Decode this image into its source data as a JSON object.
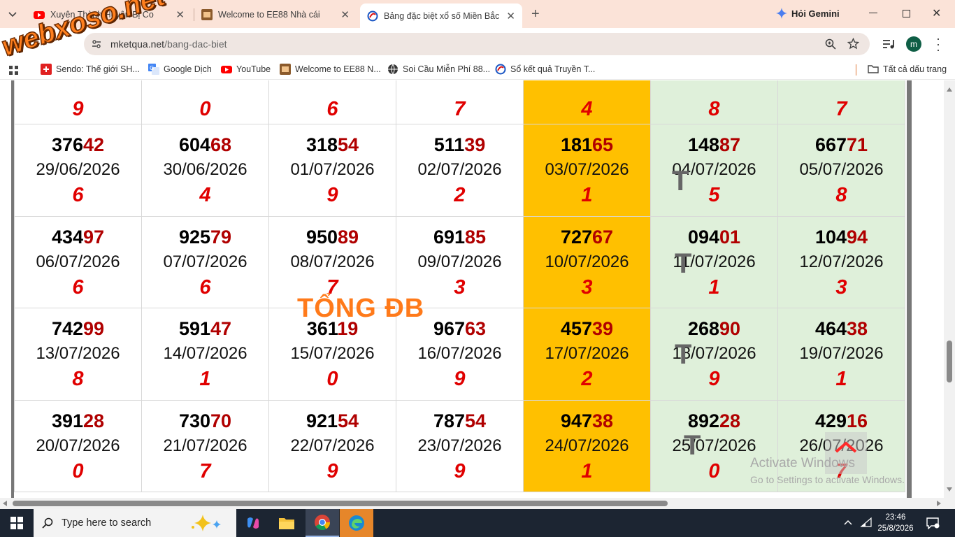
{
  "browser": {
    "tabs": [
      {
        "title": "Xuyên Thành Huyện Bị Co",
        "icon": "youtube-icon"
      },
      {
        "title": "Welcome to EE88 Nhà cái",
        "icon": "ee88-icon"
      },
      {
        "title": "Bảng đặc biệt xổ số Miền Bắc th",
        "icon": "site-icon"
      }
    ],
    "new_tab": "+",
    "gemini": "Hỏi Gemini",
    "url_host": "mketqua.net",
    "url_path": "/bang-dac-biet",
    "profile_initial": "m",
    "bookmarks": [
      {
        "label": "Sendo: Thế giới SH...",
        "icon": "sendo-icon"
      },
      {
        "label": "Google Dịch",
        "icon": "translate-icon"
      },
      {
        "label": "YouTube",
        "icon": "youtube-icon"
      },
      {
        "label": "Welcome to EE88 N...",
        "icon": "ee88-icon"
      },
      {
        "label": "Soi Cầu Miễn Phí 88...",
        "icon": "globe-icon"
      },
      {
        "label": "Sổ kết quả Truyền T...",
        "icon": "site-icon"
      }
    ],
    "all_bookmarks": "Tất cả dấu trang"
  },
  "watermark": {
    "logo": "webxoso.net",
    "overlay": "TỔNG ĐB",
    "t_mark": "T"
  },
  "table": {
    "top_totals": [
      "9",
      "0",
      "6",
      "7",
      "4",
      "8",
      "7"
    ],
    "rows": [
      [
        {
          "head": "376",
          "tail": "42",
          "date": "29/06/2026",
          "total": "6"
        },
        {
          "head": "604",
          "tail": "68",
          "date": "30/06/2026",
          "total": "4"
        },
        {
          "head": "318",
          "tail": "54",
          "date": "01/07/2026",
          "total": "9"
        },
        {
          "head": "511",
          "tail": "39",
          "date": "02/07/2026",
          "total": "2"
        },
        {
          "head": "181",
          "tail": "65",
          "date": "03/07/2026",
          "total": "1"
        },
        {
          "head": "148",
          "tail": "87",
          "date": "04/07/2026",
          "total": "5"
        },
        {
          "head": "667",
          "tail": "71",
          "date": "05/07/2026",
          "total": "8"
        }
      ],
      [
        {
          "head": "434",
          "tail": "97",
          "date": "06/07/2026",
          "total": "6"
        },
        {
          "head": "925",
          "tail": "79",
          "date": "07/07/2026",
          "total": "6"
        },
        {
          "head": "950",
          "tail": "89",
          "date": "08/07/2026",
          "total": "7"
        },
        {
          "head": "691",
          "tail": "85",
          "date": "09/07/2026",
          "total": "3"
        },
        {
          "head": "727",
          "tail": "67",
          "date": "10/07/2026",
          "total": "3"
        },
        {
          "head": "094",
          "tail": "01",
          "date": "11/07/2026",
          "total": "1"
        },
        {
          "head": "104",
          "tail": "94",
          "date": "12/07/2026",
          "total": "3"
        }
      ],
      [
        {
          "head": "742",
          "tail": "99",
          "date": "13/07/2026",
          "total": "8"
        },
        {
          "head": "591",
          "tail": "47",
          "date": "14/07/2026",
          "total": "1"
        },
        {
          "head": "361",
          "tail": "19",
          "date": "15/07/2026",
          "total": "0"
        },
        {
          "head": "967",
          "tail": "63",
          "date": "16/07/2026",
          "total": "9"
        },
        {
          "head": "457",
          "tail": "39",
          "date": "17/07/2026",
          "total": "2"
        },
        {
          "head": "268",
          "tail": "90",
          "date": "18/07/2026",
          "total": "9"
        },
        {
          "head": "464",
          "tail": "38",
          "date": "19/07/2026",
          "total": "1"
        }
      ],
      [
        {
          "head": "391",
          "tail": "28",
          "date": "20/07/2026",
          "total": "0"
        },
        {
          "head": "730",
          "tail": "70",
          "date": "21/07/2026",
          "total": "7"
        },
        {
          "head": "921",
          "tail": "54",
          "date": "22/07/2026",
          "total": "9"
        },
        {
          "head": "787",
          "tail": "54",
          "date": "23/07/2026",
          "total": "9"
        },
        {
          "head": "947",
          "tail": "38",
          "date": "24/07/2026",
          "total": "1"
        },
        {
          "head": "892",
          "tail": "28",
          "date": "25/07/2026",
          "total": "0"
        },
        {
          "head": "429",
          "tail": "16",
          "date": "26/07/2026",
          "total": "7"
        }
      ]
    ],
    "colors": {
      "highlight": "#ffc000",
      "weekend": "#dff0da",
      "total": "#e00000",
      "tail": "#b00000"
    }
  },
  "activation": {
    "line1": "Activate Windows",
    "line2": "Go to Settings to activate Windows."
  },
  "taskbar": {
    "search_placeholder": "Type here to search",
    "time": "23:46",
    "date": "25/8/2026"
  }
}
